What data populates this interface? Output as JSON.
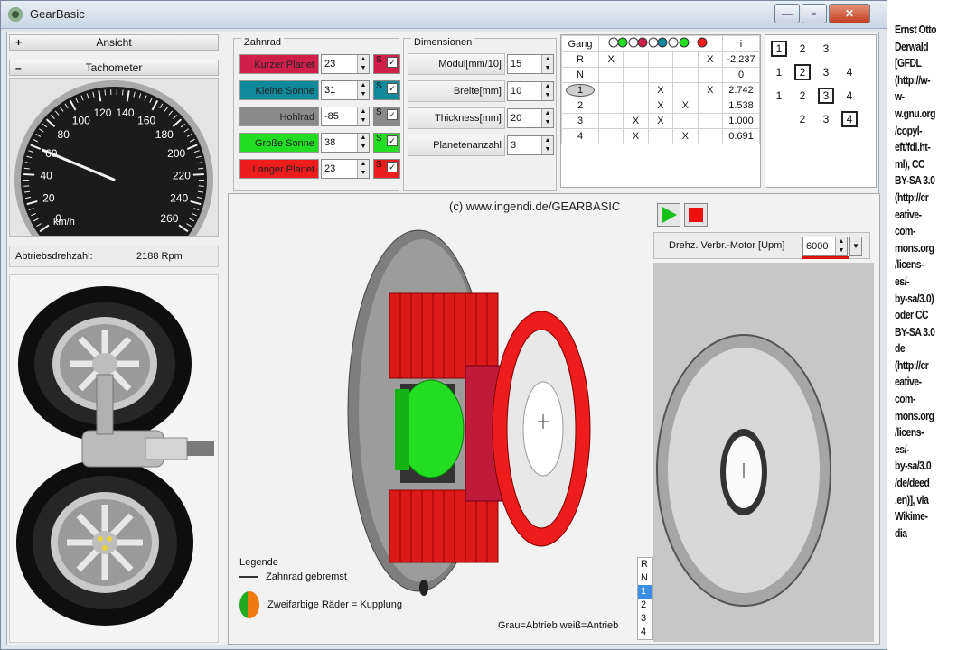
{
  "window": {
    "title": "GearBasic",
    "buttons": {
      "minimize": "—",
      "maximize": "▫",
      "close": "✕"
    }
  },
  "left": {
    "ansicht": {
      "sign": "+",
      "label": "Ansicht"
    },
    "tacho": {
      "sign": "–",
      "label": "Tachometer"
    },
    "gauge": {
      "ticks": [
        "0",
        "20",
        "40",
        "60",
        "80",
        "100",
        "120",
        "140",
        "160",
        "180",
        "200",
        "220",
        "240",
        "260"
      ],
      "unit": "km/h",
      "value": 60
    },
    "output": {
      "label": "Abtriebsdrehzahl:",
      "value": "2188 Rpm"
    }
  },
  "zahnrad": {
    "title": "Zahnrad",
    "rows": [
      {
        "label": "Kurzer Planet",
        "value": "23",
        "color": "#d0204a",
        "s": "S",
        "checked": true
      },
      {
        "label": "Kleine Sonne",
        "value": "31",
        "color": "#108a9a",
        "s": "S",
        "checked": true
      },
      {
        "label": "Hohlrad",
        "value": "-85",
        "color": "#8a8a8a",
        "s": "S",
        "checked": true
      },
      {
        "label": "Große Sonne",
        "value": "38",
        "color": "#22dd22",
        "s": "S",
        "checked": true
      },
      {
        "label": "Langer Planet",
        "value": "23",
        "color": "#ee1c1c",
        "s": "S",
        "checked": true
      }
    ]
  },
  "dimensionen": {
    "title": "Dimensionen",
    "rows": [
      {
        "label": "Modul[mm/10]",
        "value": "15"
      },
      {
        "label": "Breite[mm]",
        "value": "10"
      },
      {
        "label": "Thickness[mm]",
        "value": "20"
      },
      {
        "label": "Planetenanzahl",
        "value": "3"
      }
    ]
  },
  "gang_table": {
    "header": {
      "gang": "Gang",
      "i": "i"
    },
    "rows": [
      {
        "gang": "R",
        "marks": [
          "X",
          "",
          "",
          "",
          "X"
        ],
        "i": "-2.237"
      },
      {
        "gang": "N",
        "marks": [
          "",
          "",
          "",
          "",
          ""
        ],
        "i": "0"
      },
      {
        "gang": "1",
        "marks": [
          "",
          "",
          "X",
          "",
          "X"
        ],
        "i": "2.742"
      },
      {
        "gang": "2",
        "marks": [
          "",
          "",
          "X",
          "X",
          ""
        ],
        "i": "1.538"
      },
      {
        "gang": "3",
        "marks": [
          "",
          "X",
          "X",
          "",
          ""
        ],
        "i": "1.000"
      },
      {
        "gang": "4",
        "marks": [
          "",
          "X",
          "",
          "X",
          ""
        ],
        "i": "0.691"
      }
    ]
  },
  "matrix": {
    "cells": [
      "1",
      "2",
      "3",
      "1",
      "2",
      "3",
      "4",
      "1",
      "2",
      "3",
      "4",
      "2",
      "3",
      "4"
    ]
  },
  "view": {
    "copyright": "(c) www.ingendi.de/GEARBASIC",
    "motor_label": "Drehz. Verbr.-Motor [Upm]",
    "motor_value": "6000",
    "legend_title": "Legende",
    "legend_braked": "Zahnrad gebremst",
    "legend_coupling": "Zweifarbige Räder = Kupplung",
    "legend_colors": "Grau=Abtrieb weiß=Antrieb",
    "gear_select": [
      "R",
      "N",
      "1",
      "2",
      "3",
      "4"
    ],
    "selected_gear": "1"
  },
  "attribution": "Ernst Otto Derwald [GFDL (http://www.gnu.org/copyleft/fdl.html), CC BY-SA 3.0 (http://creativecommons.org/licenses/by-sa/3.0) oder CC BY-SA 3.0 de (http://creativecommons.org/licenses/by-sa/3.0/de/deed.en)], via Wikimedia",
  "attribution_lines": [
    "Ernst Otto",
    "Derwald",
    "[GFDL",
    "(http://w-",
    "w-",
    "w.gnu.org",
    "/copyl-",
    "eft/fdl.ht-",
    "ml), CC",
    "BY-SA 3.0",
    "(http://cr",
    "eative-",
    "com-",
    "mons.org",
    "/licens-",
    "es/-",
    "by-sa/3.0)",
    "oder CC",
    "BY-SA 3.0",
    "de",
    "(http://cr",
    "eative-",
    "com-",
    "mons.org",
    "/licens-",
    "es/-",
    "by-sa/3.0",
    "/de/deed",
    ".en)], via",
    "Wikime-",
    "dia"
  ]
}
